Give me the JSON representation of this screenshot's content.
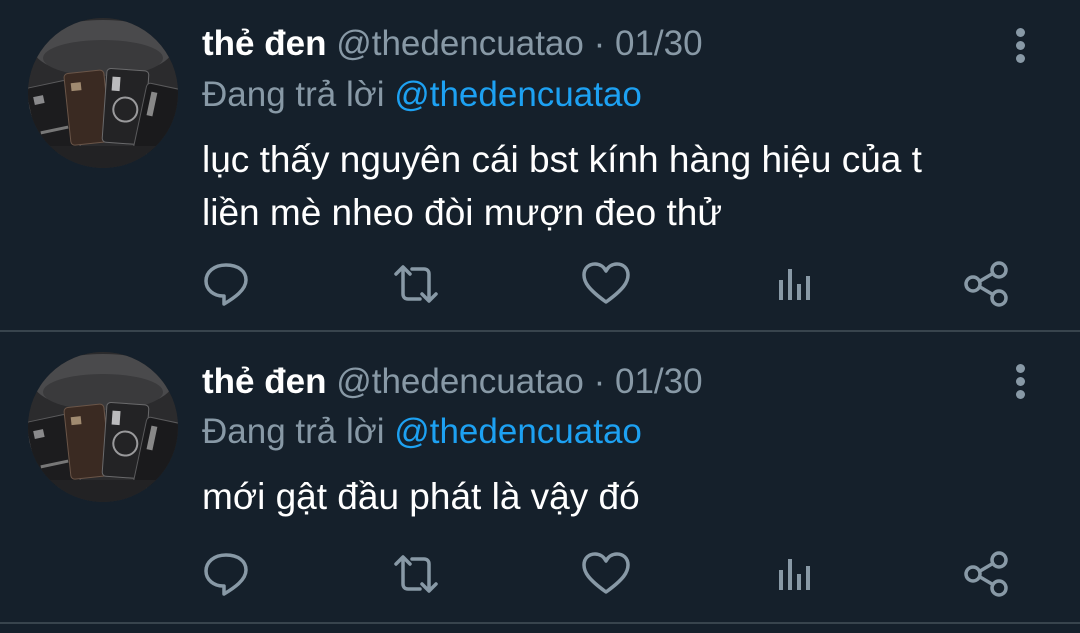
{
  "tweets": [
    {
      "display_name": "thẻ đen",
      "handle": "@thedencuatao",
      "separator": "·",
      "date": "01/30",
      "reply_prefix": "Đang trả lời",
      "reply_mention": "@thedencuatao",
      "text_lines": [
        "lục thấy nguyên cái bst kính hàng hiệu của t",
        "liền mè nheo đòi mượn đeo thử"
      ]
    },
    {
      "display_name": "thẻ đen",
      "handle": "@thedencuatao",
      "separator": "·",
      "date": "01/30",
      "reply_prefix": "Đang trả lời",
      "reply_mention": "@thedencuatao",
      "text_lines": [
        "mới gật đầu phát là vậy đó"
      ]
    }
  ],
  "icons": {
    "reply": "reply-icon",
    "retweet": "retweet-icon",
    "like": "heart-icon",
    "analytics": "analytics-icon",
    "share": "share-icon",
    "more": "more-vertical-icon"
  },
  "colors": {
    "background": "#15202b",
    "divider": "#38444d",
    "primary_text": "#ffffff",
    "secondary_text": "#8899a6",
    "accent": "#1da1f2"
  }
}
